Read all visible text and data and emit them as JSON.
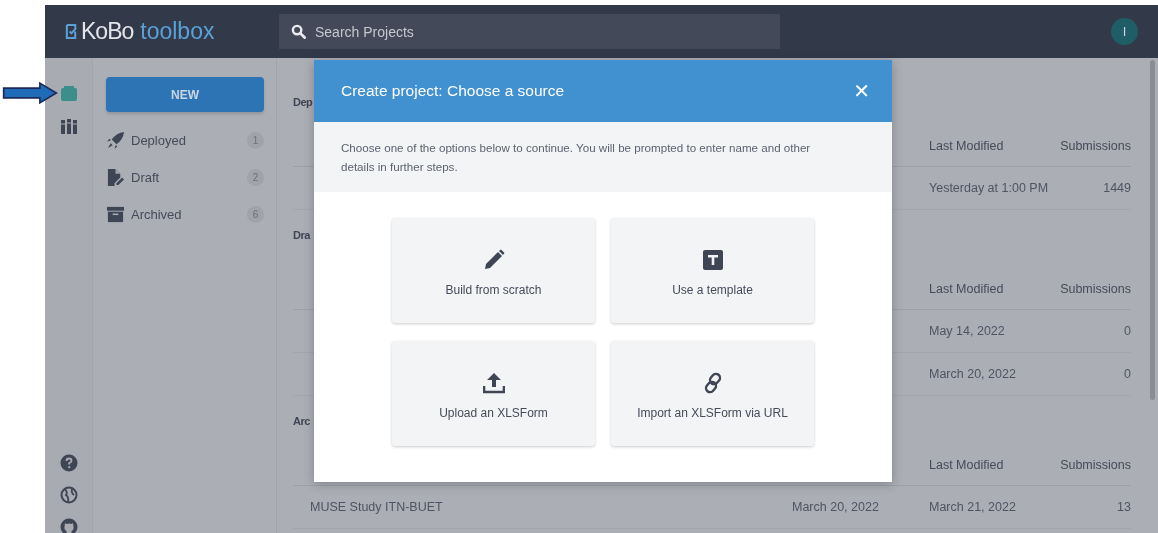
{
  "header": {
    "logo_prefix": "KoBo",
    "logo_suffix": "toolbox",
    "search": {
      "placeholder": "Search Projects"
    },
    "avatar": "I"
  },
  "icon_rail": [
    {
      "kind": "projects",
      "selected": true
    },
    {
      "kind": "library",
      "selected": false
    }
  ],
  "sidebar": {
    "new_button": "NEW",
    "items": [
      {
        "kind": "deployed",
        "label": "Deployed",
        "count": "1"
      },
      {
        "kind": "draft",
        "label": "Draft",
        "count": "2"
      },
      {
        "kind": "archived",
        "label": "Archived",
        "count": "6"
      }
    ]
  },
  "sections": [
    {
      "title": "Dep",
      "columns": [
        "Last Modified",
        "Submissions"
      ],
      "rows": [
        {
          "modified": "Yesterday at 1:00 PM",
          "submissions": "1449"
        }
      ]
    },
    {
      "title": "Dra",
      "columns": [
        "Last Modified",
        "Submissions"
      ],
      "rows": [
        {
          "modified": "May 14, 2022",
          "submissions": "0"
        },
        {
          "modified": "March 20, 2022",
          "submissions": "0"
        }
      ]
    },
    {
      "title": "Arc",
      "columns": [
        "Last Modified",
        "Submissions"
      ],
      "rows": [
        {
          "name": "MUSE Study ITN-BUET",
          "created": "March 20, 2022",
          "modified": "March 21, 2022",
          "submissions": "13"
        }
      ]
    }
  ],
  "modal": {
    "title": "Create project: Choose a source",
    "close": "✕",
    "description": "Choose one of the options below to continue. You will be prompted to enter name and other details in further steps.",
    "options": [
      {
        "kind": "scratch",
        "label": "Build from scratch"
      },
      {
        "kind": "template",
        "label": "Use a template"
      },
      {
        "kind": "upload",
        "label": "Upload an XLSForm"
      },
      {
        "kind": "url",
        "label": "Import an XLSForm via URL"
      }
    ]
  }
}
